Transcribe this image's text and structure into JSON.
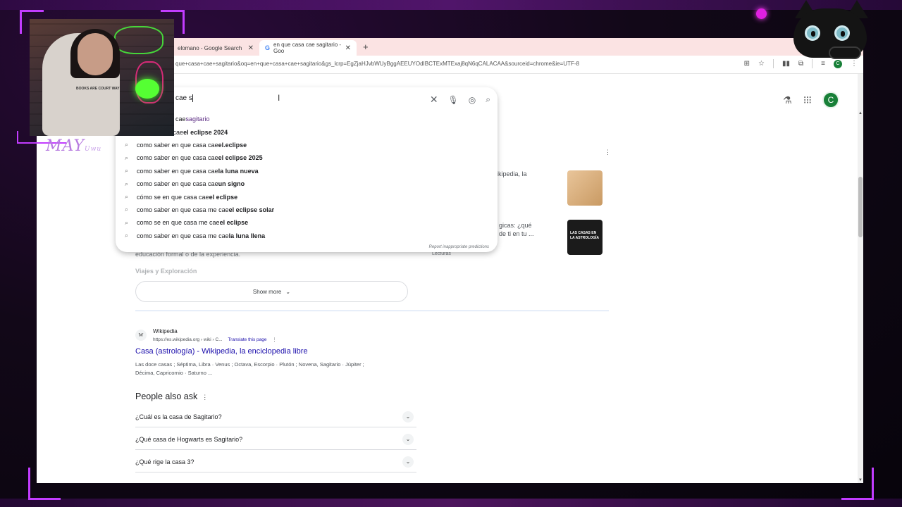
{
  "browser": {
    "tabs": [
      {
        "label": "elomano - Google Search"
      },
      {
        "label": "en que casa cae sagitario - Goo"
      }
    ],
    "new_tab": "+",
    "url": "que+casa+cae+sagitario&oq=en+que+casa+cae+sagitario&gs_lcrp=EgZjaHJvbWUyBggAEEUYOdIBCTExMTExaj8qN6qCALACAA&sourceid=chrome&ie=UTF-8",
    "account_initial": "C"
  },
  "search": {
    "query": "cae s",
    "suggestions": [
      {
        "pre": "cae ",
        "bold": "sagitario"
      },
      {
        "pre": "en que casa cae ",
        "bold": "el eclipse 2024"
      },
      {
        "pre": "como saber en que casa cae ",
        "bold": "el.eclipse"
      },
      {
        "pre": "como saber en que casa cae ",
        "bold": "el eclipse 2025"
      },
      {
        "pre": "como saber en que casa cae ",
        "bold": "la luna nueva"
      },
      {
        "pre": "como saber en que casa cae ",
        "bold": "un signo"
      },
      {
        "pre": "cómo se en que casa cae ",
        "bold": "el eclipse"
      },
      {
        "pre": "como saber en que casa me cae ",
        "bold": "el eclipse solar"
      },
      {
        "pre": "como se en que casa me cae ",
        "bold": "el eclipse"
      },
      {
        "pre": "como saber en que casa me cae ",
        "bold": "la luna llena"
      }
    ],
    "report_text": "Report inappropriate predictions"
  },
  "results": {
    "kp_snippet1": "ikipedia, la",
    "kp_snippet2_line1": "gicas: ¿qué",
    "kp_snippet2_line2": "de ti en tu ...",
    "kp_thumb2_text": "LAS CASAS EN LA ASTROLOGÍA",
    "kp_source": "Lecturas",
    "faded_snippet": "educación formal o de la experiencia.",
    "faded_heading": "Viajes y Exploración",
    "show_more": "Show more",
    "wiki": {
      "site": "Wikipedia",
      "url": "https://es.wikipedia.org › wiki › C...",
      "translate": "Translate this page",
      "title": "Casa (astrología) - Wikipedia, la enciclopedia libre",
      "snippet_line1": "Las doce casas ; Séptima, Libra · Venus ; Octava, Escorpio · Plutón ; Novena, Sagitario · Júpiter ;",
      "snippet_line2": "Décima, Capricornio · Saturno ..."
    },
    "paa_title": "People also ask",
    "questions": [
      "¿Cuál es la casa de Sagitario?",
      "¿Qué casa de Hogwarts es Sagitario?",
      "¿Qué rige la casa 3?"
    ]
  },
  "overlay": {
    "streamer_name": "MAY",
    "streamer_suffix": "Uwu",
    "shirt_text": "BOOKS ARE COURT WAY"
  }
}
